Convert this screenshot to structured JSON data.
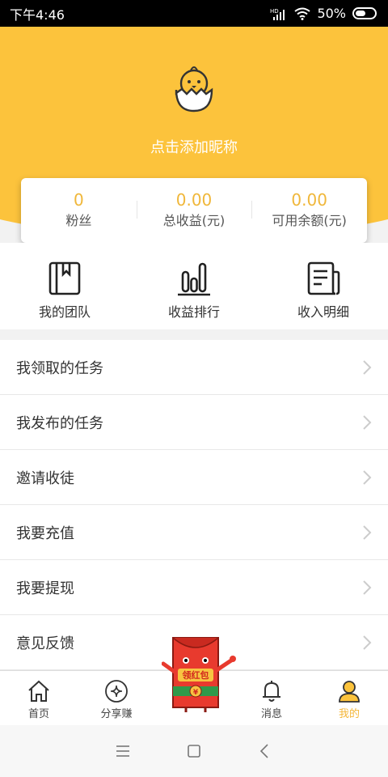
{
  "status_bar": {
    "time": "下午4:46",
    "battery": "50%"
  },
  "profile": {
    "nickname_prompt": "点击添加昵称"
  },
  "stats": [
    {
      "value": "0",
      "label": "粉丝"
    },
    {
      "value": "0.00",
      "label": "总收益(元)"
    },
    {
      "value": "0.00",
      "label": "可用余额(元)"
    }
  ],
  "quick_actions": [
    {
      "label": "我的团队",
      "icon": "book-icon"
    },
    {
      "label": "收益排行",
      "icon": "bar-chart-icon"
    },
    {
      "label": "收入明细",
      "icon": "document-icon"
    }
  ],
  "menu": [
    {
      "label": "我领取的任务"
    },
    {
      "label": "我发布的任务"
    },
    {
      "label": "邀请收徒"
    },
    {
      "label": "我要充值"
    },
    {
      "label": "我要提现"
    },
    {
      "label": "意见反馈"
    }
  ],
  "tabs": [
    {
      "label": "首页",
      "icon": "home-icon"
    },
    {
      "label": "分享赚",
      "icon": "share-earn-icon"
    },
    {
      "label": "消息",
      "icon": "bell-icon"
    },
    {
      "label": "我的",
      "icon": "user-icon",
      "active": true
    }
  ],
  "red_packet": {
    "label": "领红包"
  },
  "colors": {
    "accent": "#fcc33c",
    "value": "#f0b73a"
  }
}
